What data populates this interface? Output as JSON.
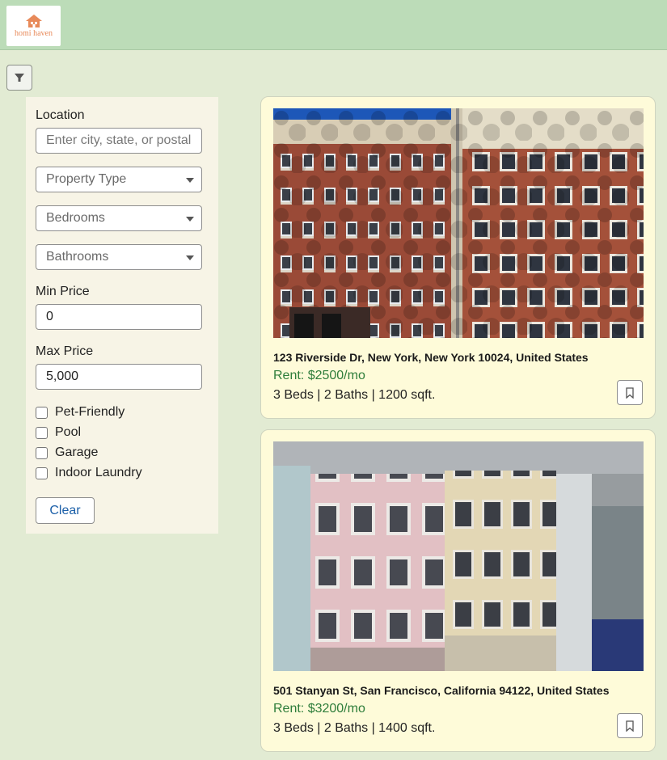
{
  "header": {
    "logo_text": "homi haven",
    "logo_icon": "house-icon",
    "brand_color": "#e88a5a"
  },
  "filters": {
    "toggle_icon": "funnel-icon",
    "location_label": "Location",
    "location_placeholder": "Enter city, state, or postal code",
    "property_type": "Property Type",
    "bedrooms": "Bedrooms",
    "bathrooms": "Bathrooms",
    "min_price_label": "Min Price",
    "min_price_value": "0",
    "max_price_label": "Max Price",
    "max_price_value": "5,000",
    "amenities": [
      "Pet-Friendly",
      "Pool",
      "Garage",
      "Indoor Laundry"
    ],
    "clear_label": "Clear"
  },
  "listings": [
    {
      "address": "123 Riverside Dr, New York, New York 10024, United States",
      "rent": "Rent: $2500/mo",
      "details": "3 Beds | 2 Baths | 1200 sqft.",
      "bookmark_icon": "bookmark-icon"
    },
    {
      "address": "501 Stanyan St, San Francisco, California 94122, United States",
      "rent": "Rent: $3200/mo",
      "details": "3 Beds | 2 Baths | 1400 sqft.",
      "bookmark_icon": "bookmark-icon"
    }
  ],
  "colors": {
    "background": "#e2ebd3",
    "header": "#bcdcb8",
    "panel": "#f7f4e6",
    "card": "#fefbd9",
    "rent": "#2e7d3a",
    "link": "#1b5fa8"
  }
}
